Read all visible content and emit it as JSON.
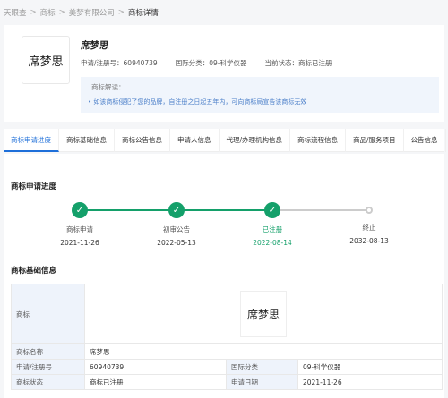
{
  "breadcrumb": {
    "items": [
      "天眼查",
      "商标",
      "美梦有限公司",
      "商标详情"
    ],
    "separator": ">"
  },
  "header": {
    "logo_text": "席梦思",
    "name": "席梦思",
    "reg_no_label": "申请/注册号：",
    "reg_no": "60940739",
    "intl_class_label": "国际分类：",
    "intl_class": "09-科学仪器",
    "status_label": "当前状态：",
    "status": "商标已注册",
    "note": {
      "title": "商标解读：",
      "text": "• 如该商标侵犯了您的品牌，自注册之日起五年内，可向商标局宣告该商标无效"
    }
  },
  "tabs": [
    "商标申请进度",
    "商标基础信息",
    "商标公告信息",
    "申请人信息",
    "代理/办理机构信息",
    "商标流程信息",
    "商品/服务项目",
    "公告信息"
  ],
  "progress": {
    "title": "商标申请进度",
    "steps": [
      {
        "label": "商标申请",
        "date": "2021-11-26",
        "state": "done"
      },
      {
        "label": "初审公告",
        "date": "2022-05-13",
        "state": "done"
      },
      {
        "label": "已注册",
        "date": "2022-08-14",
        "state": "current"
      },
      {
        "label": "终止",
        "date": "2032-08-13",
        "state": "pending"
      }
    ],
    "colors": {
      "done": "#14a06a",
      "pending": "#cccccc"
    }
  },
  "basic_info": {
    "title": "商标基础信息",
    "trademark_label": "商标",
    "trademark_image_text": "席梦思",
    "rows": [
      {
        "label": "商标名称",
        "value": "席梦思"
      },
      {
        "label": "申请/注册号",
        "value": "60940739",
        "label2": "国际分类",
        "value2": "09-科学仪器"
      },
      {
        "label": "商标状态",
        "value": "商标已注册",
        "label2": "申请日期",
        "value2": "2021-11-26"
      }
    ]
  }
}
